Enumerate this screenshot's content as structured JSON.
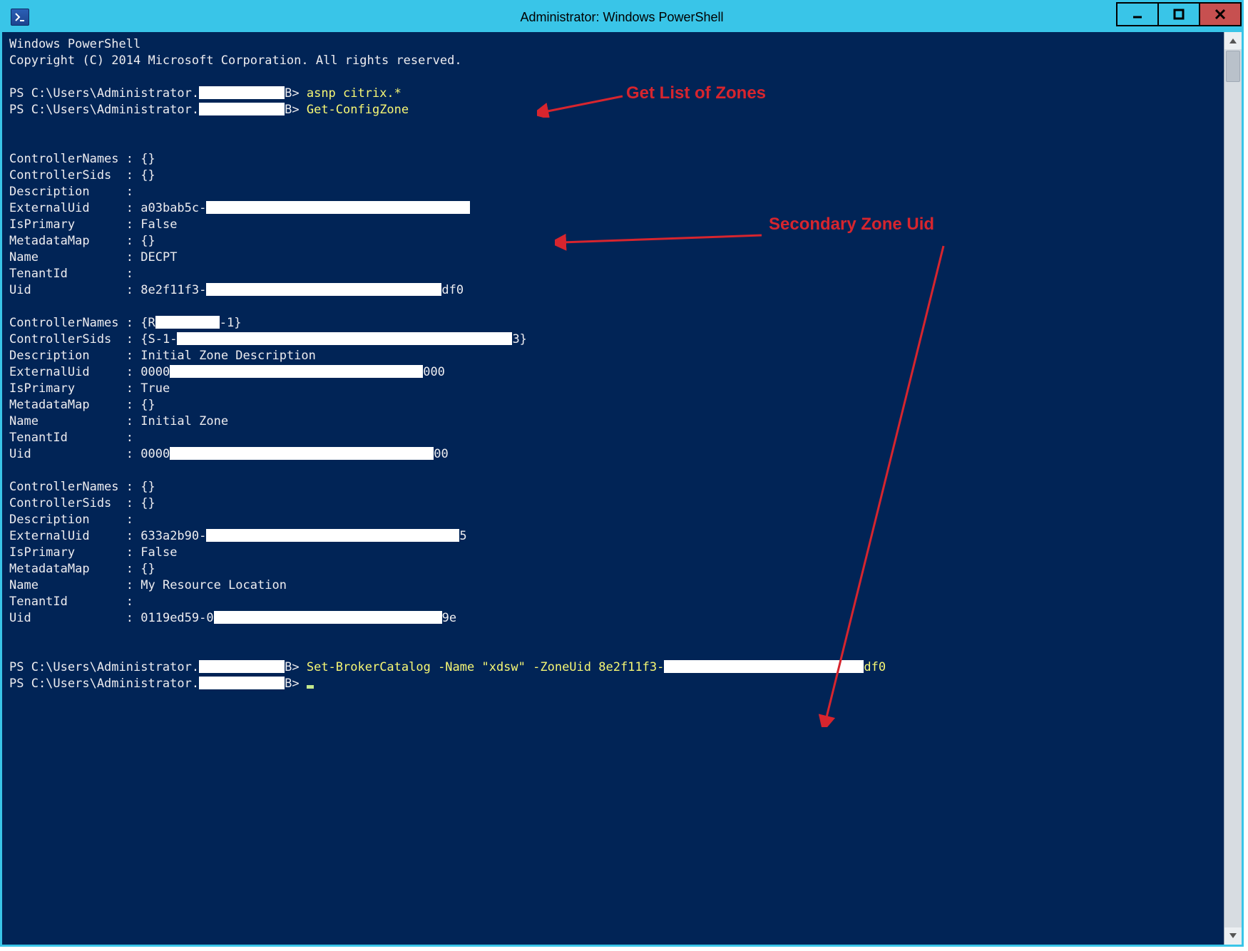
{
  "window": {
    "title": "Administrator: Windows PowerShell"
  },
  "header": {
    "line1": "Windows PowerShell",
    "line2": "Copyright (C) 2014 Microsoft Corporation. All rights reserved."
  },
  "prompt_prefix": "PS C:\\Users\\Administrator.",
  "prompt_suffix": "B>",
  "commands": {
    "cmd1": "asnp citrix.*",
    "cmd2": "Get-ConfigZone",
    "cmd3_a": "Set-BrokerCatalog -Name \"xdsw\" -ZoneUid 8e2f11f3-",
    "cmd3_b": "df0"
  },
  "zones": [
    {
      "ControllerNames": "{}",
      "ControllerSids": "{}",
      "Description": "",
      "ExternalUid_pre": "a03bab5c-",
      "ExternalUid_post": "",
      "IsPrimary": "False",
      "MetadataMap": "{}",
      "Name": "DECPT",
      "TenantId": "",
      "Uid_pre": "8e2f11f3-",
      "Uid_post": "df0"
    },
    {
      "ControllerNames_pre": "{R",
      "ControllerNames_post": "-1}",
      "ControllerSids_pre": "{S-1-",
      "ControllerSids_post": "3}",
      "Description": "Initial Zone Description",
      "ExternalUid_pre": "0000",
      "ExternalUid_post": "000",
      "IsPrimary": "True",
      "MetadataMap": "{}",
      "Name": "Initial Zone",
      "TenantId": "",
      "Uid_pre": "0000",
      "Uid_post": "00"
    },
    {
      "ControllerNames": "{}",
      "ControllerSids": "{}",
      "Description": "",
      "ExternalUid_pre": "633a2b90-",
      "ExternalUid_post": "5",
      "IsPrimary": "False",
      "MetadataMap": "{}",
      "Name": "My Resource Location",
      "TenantId": "",
      "Uid_pre": "0119ed59-0",
      "Uid_post": "9e"
    }
  ],
  "annotations": {
    "a1": "Get List of Zones",
    "a2": "Secondary Zone Uid"
  },
  "labels": {
    "ControllerNames": "ControllerNames",
    "ControllerSids": "ControllerSids",
    "Description": "Description",
    "ExternalUid": "ExternalUid",
    "IsPrimary": "IsPrimary",
    "MetadataMap": "MetadataMap",
    "Name": "Name",
    "TenantId": "TenantId",
    "Uid": "Uid"
  }
}
